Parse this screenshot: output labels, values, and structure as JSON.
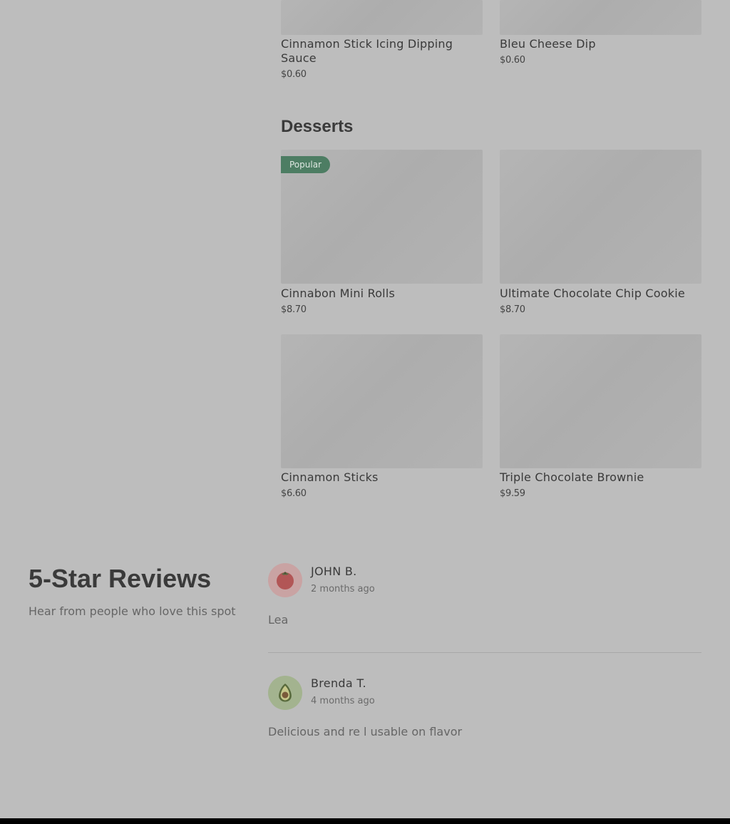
{
  "menu": {
    "top_items": [
      {
        "name": "Cinnamon Stick Icing Dipping Sauce",
        "price": "$0.60"
      },
      {
        "name": "Bleu Cheese Dip",
        "price": "$0.60"
      }
    ],
    "desserts": {
      "title": "Desserts",
      "items": [
        {
          "name": "Cinnabon Mini Rolls",
          "price": "$8.70",
          "badge": "Popular"
        },
        {
          "name": "Ultimate Chocolate Chip Cookie",
          "price": "$8.70"
        },
        {
          "name": "Cinnamon Sticks",
          "price": "$6.60"
        },
        {
          "name": "Triple Chocolate Brownie",
          "price": "$9.59"
        }
      ]
    }
  },
  "reviews": {
    "title": "5-Star Reviews",
    "subtitle": "Hear from people who love this spot",
    "items": [
      {
        "name": "JOHN B.",
        "time": "2 months ago",
        "text": "Lea",
        "avatar_icon": "tomato-icon"
      },
      {
        "name": "Brenda T.",
        "time": "4 months ago",
        "text": "Delicious and re l usable on flavor",
        "avatar_icon": "avocado-icon"
      }
    ]
  },
  "colors": {
    "badge": "#4d7d63",
    "avatar_tomato_bg": "#c9a3a3",
    "avatar_avocado_bg": "#a3b38f"
  }
}
